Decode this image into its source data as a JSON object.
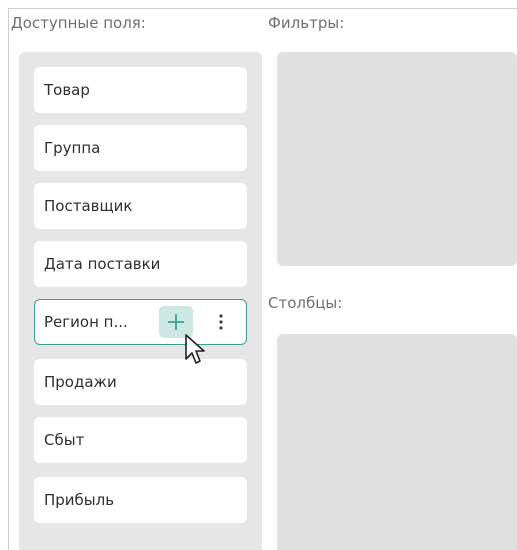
{
  "labels": {
    "available_fields": "Доступные поля:",
    "filters": "Фильтры:",
    "columns": "Столбцы:"
  },
  "fields": [
    {
      "label": "Товар"
    },
    {
      "label": "Группа"
    },
    {
      "label": "Поставщик"
    },
    {
      "label": "Дата поставки"
    },
    {
      "label": "Регион п...",
      "selected": true
    },
    {
      "label": "Продажи"
    },
    {
      "label": "Сбыт"
    },
    {
      "label": "Прибыль"
    }
  ],
  "icons": {
    "add": "plus-icon",
    "more": "more-vertical-icon",
    "cursor": "mouse-pointer-icon"
  },
  "colors": {
    "accent": "#3aa191",
    "accent_light": "#cde8e3",
    "panel_bg": "#e6e6e6"
  }
}
